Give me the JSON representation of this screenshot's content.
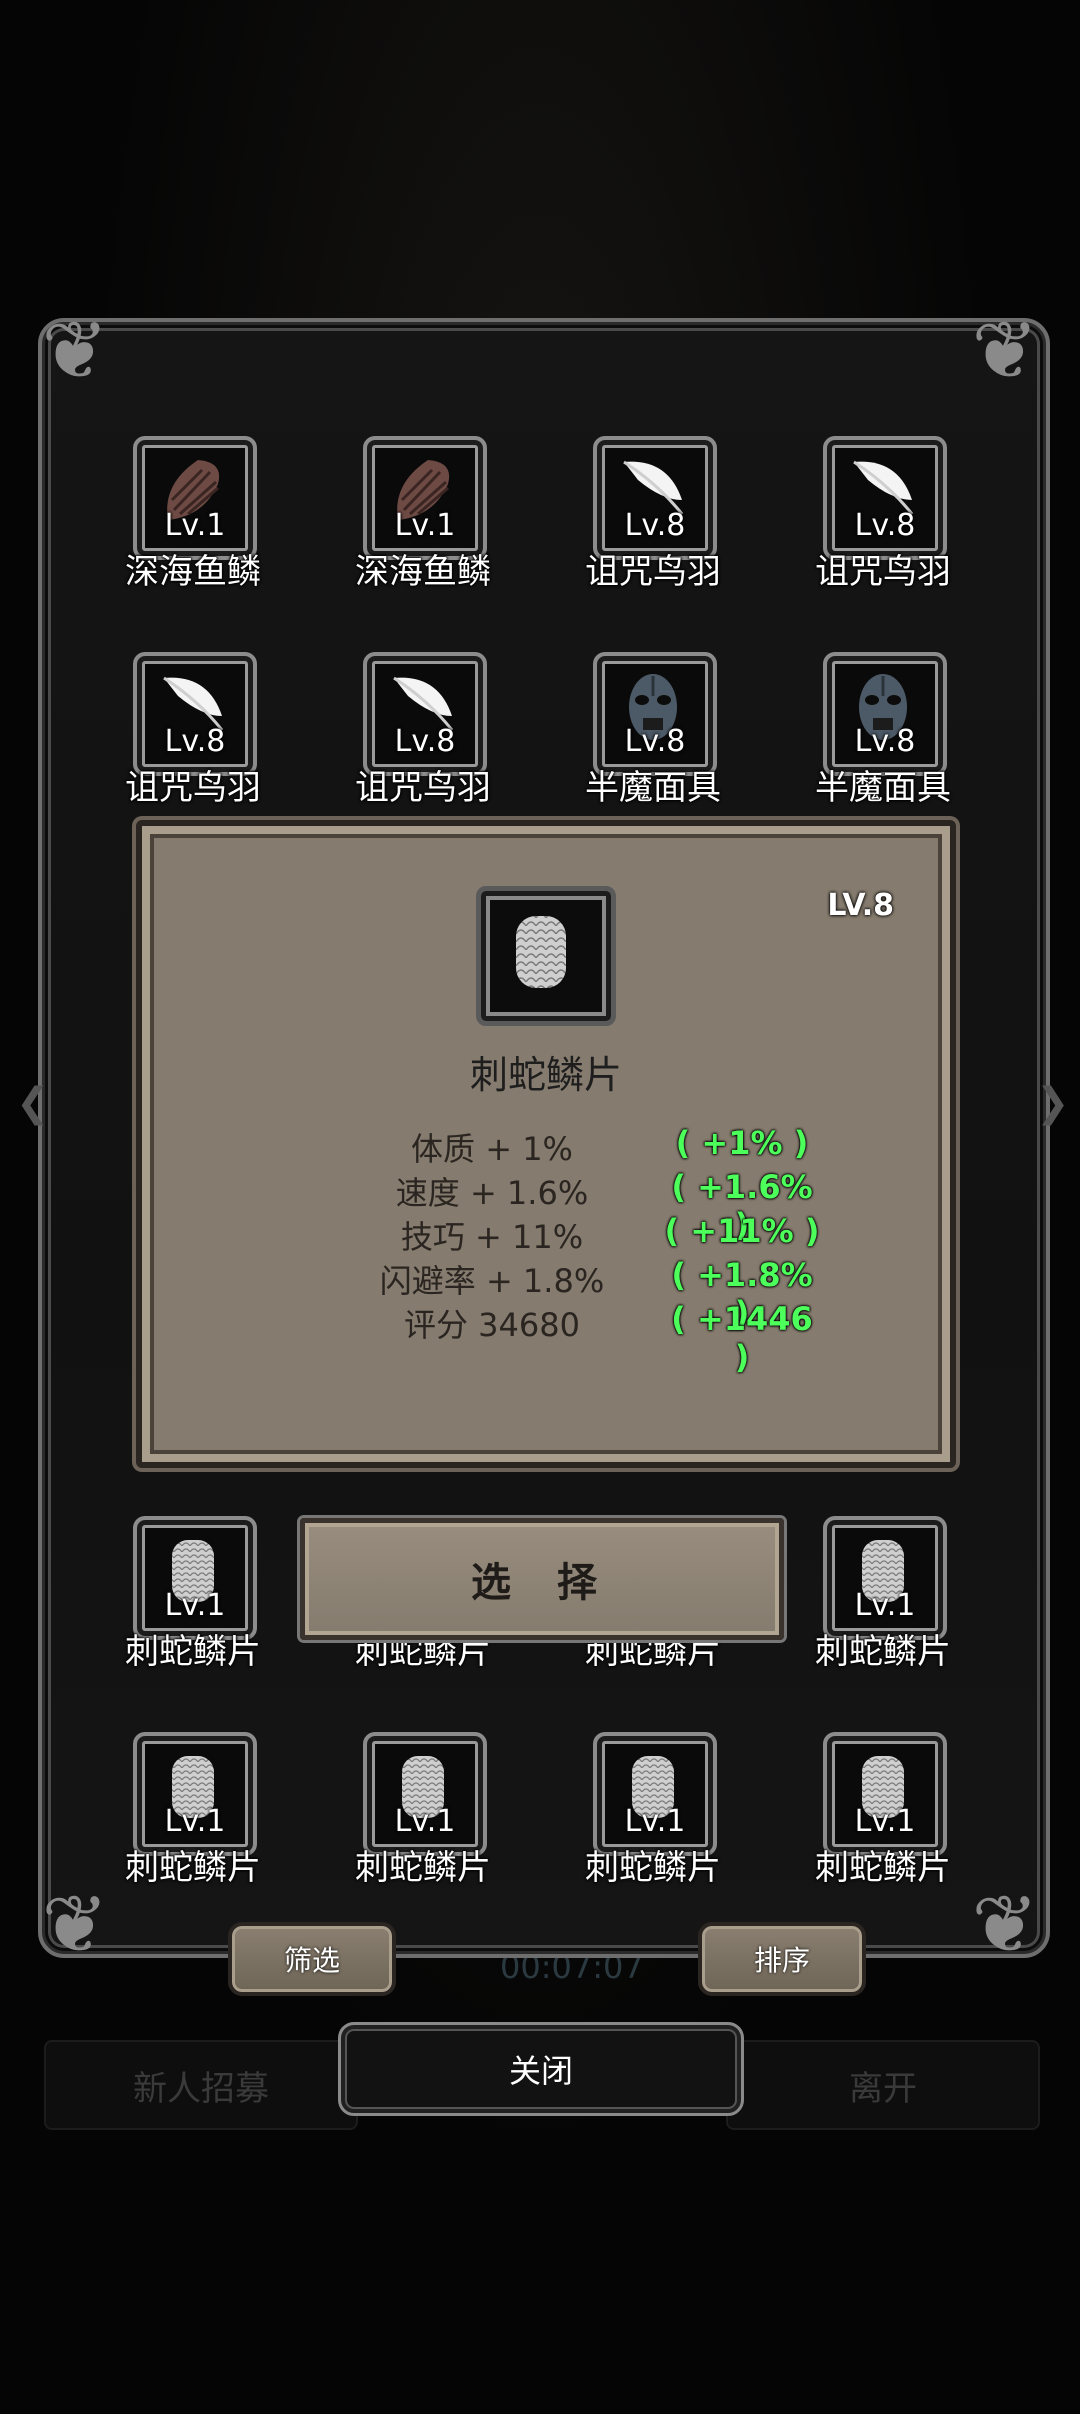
{
  "background": {
    "left_button": "新人招募",
    "right_button": "离开",
    "timer": "00:07:07"
  },
  "inventory": [
    {
      "level": "Lv.1",
      "name": "深海鱼鳞",
      "icon": "fish-scale-icon"
    },
    {
      "level": "Lv.1",
      "name": "深海鱼鳞",
      "icon": "fish-scale-icon"
    },
    {
      "level": "Lv.8",
      "name": "诅咒鸟羽",
      "icon": "feather-icon"
    },
    {
      "level": "Lv.8",
      "name": "诅咒鸟羽",
      "icon": "feather-icon"
    },
    {
      "level": "Lv.8",
      "name": "诅咒鸟羽",
      "icon": "feather-icon"
    },
    {
      "level": "Lv.8",
      "name": "诅咒鸟羽",
      "icon": "feather-icon"
    },
    {
      "level": "Lv.8",
      "name": "半魔面具",
      "icon": "demon-mask-icon"
    },
    {
      "level": "Lv.8",
      "name": "半魔面具",
      "icon": "demon-mask-icon"
    },
    {
      "level": "Lv.1",
      "name": "刺蛇鳞片",
      "icon": "snake-scale-icon"
    },
    {
      "level": "",
      "name": "刺蛇鳞片",
      "icon": "snake-scale-icon"
    },
    {
      "level": "",
      "name": "刺蛇鳞片",
      "icon": "snake-scale-icon"
    },
    {
      "level": "Lv.1",
      "name": "刺蛇鳞片",
      "icon": "snake-scale-icon"
    },
    {
      "level": "Lv.1",
      "name": "刺蛇鳞片",
      "icon": "snake-scale-icon"
    },
    {
      "level": "Lv.1",
      "name": "刺蛇鳞片",
      "icon": "snake-scale-icon"
    },
    {
      "level": "Lv.1",
      "name": "刺蛇鳞片",
      "icon": "snake-scale-icon"
    },
    {
      "level": "Lv.1",
      "name": "刺蛇鳞片",
      "icon": "snake-scale-icon"
    }
  ],
  "detail": {
    "level": "LV.8",
    "name": "刺蛇鳞片",
    "icon": "snake-scale-icon",
    "stats": [
      {
        "label": "体质 + 1%",
        "diff": "( +1% )"
      },
      {
        "label": "速度 + 1.6%",
        "diff": "( +1.6% )"
      },
      {
        "label": "技巧 + 11%",
        "diff": "( +11% )"
      },
      {
        "label": "闪避率 + 1.8%",
        "diff": "( +1.8% )"
      },
      {
        "label": "评分 34680",
        "diff": "( +1446 )"
      }
    ],
    "diff_color": "#4cff5a"
  },
  "buttons": {
    "select": "选 择",
    "filter": "筛选",
    "sort": "排序",
    "close": "关闭"
  }
}
